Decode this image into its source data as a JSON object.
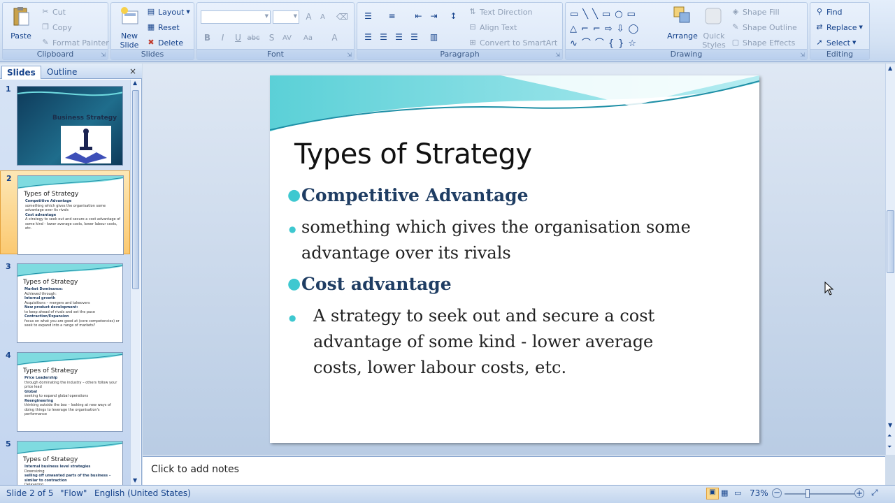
{
  "ribbon": {
    "clipboard": {
      "label": "Clipboard",
      "paste": "Paste",
      "cut": "Cut",
      "copy": "Copy",
      "format_painter": "Format Painter"
    },
    "slides": {
      "label": "Slides",
      "new_slide": "New Slide",
      "layout": "Layout",
      "reset": "Reset",
      "delete": "Delete"
    },
    "font": {
      "label": "Font"
    },
    "paragraph": {
      "label": "Paragraph",
      "text_direction": "Text Direction",
      "align_text": "Align Text",
      "convert_smartart": "Convert to SmartArt"
    },
    "drawing": {
      "label": "Drawing",
      "arrange": "Arrange",
      "quick_styles": "Quick Styles",
      "shape_fill": "Shape Fill",
      "shape_outline": "Shape Outline",
      "shape_effects": "Shape Effects"
    },
    "editing": {
      "label": "Editing",
      "find": "Find",
      "replace": "Replace",
      "select": "Select"
    }
  },
  "panel": {
    "tabs": [
      "Slides",
      "Outline"
    ],
    "thumbnails": [
      {
        "num": "1",
        "title": "Business Strategy",
        "lines": []
      },
      {
        "num": "2",
        "title": "Types of Strategy",
        "lines": [
          "Competitive Advantage",
          "something which gives the organisation some advantage over its rivals",
          "Cost advantage",
          "A strategy to seek out and secure a cost advantage of some kind - lower average costs, lower labour costs, etc."
        ]
      },
      {
        "num": "3",
        "title": "Types of Strategy",
        "lines": [
          "Market Dominance:",
          "Achieved through:",
          "Internal growth",
          "Acquisitions – mergers and takeovers",
          "New product development:",
          "to keep ahead of rivals and set the pace",
          "Contraction/Expansion",
          "focus on what you are good at (core competencies) or seek to expand into a range of markets?"
        ]
      },
      {
        "num": "4",
        "title": "Types of Strategy",
        "lines": [
          "Price Leadership",
          "through dominating the industry – others follow your price lead",
          "Global",
          "seeking to expand global operations",
          "Reengineering",
          "thinking outside the box – looking at new ways of doing things to leverage the organisation's performance"
        ]
      },
      {
        "num": "5",
        "title": "Types of Strategy",
        "lines": [
          "Internal business level strategies",
          "Downsizing",
          "selling off unwanted parts of the business – similar to contraction",
          "Delayering"
        ]
      }
    ]
  },
  "slide": {
    "title": "Types of Strategy",
    "bullets": [
      {
        "text": "Competitive Advantage",
        "heading": true
      },
      {
        "text": "something which gives the organisation some advantage over its rivals",
        "heading": false
      },
      {
        "text": "Cost advantage",
        "heading": true
      },
      {
        "text": "A strategy to seek out and secure a cost advantage of some kind - lower average costs, lower labour costs, etc.",
        "heading": false
      }
    ]
  },
  "notes": {
    "placeholder": "Click to add notes"
  },
  "status": {
    "slide_pos": "Slide 2 of 5",
    "theme": "\"Flow\"",
    "language": "English (United States)",
    "zoom": "73%"
  }
}
